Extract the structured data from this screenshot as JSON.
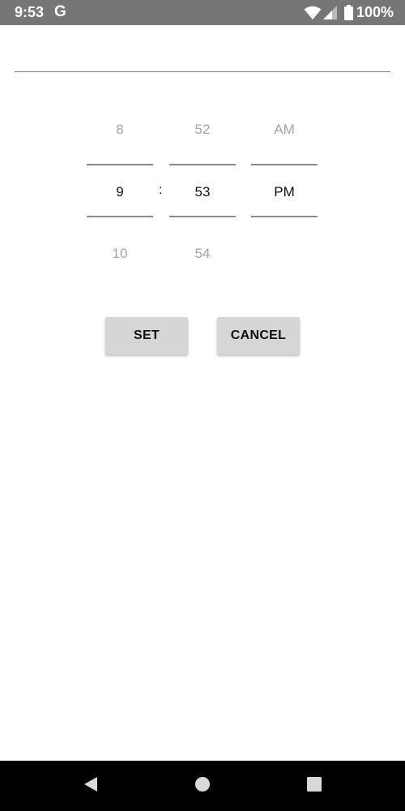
{
  "status_bar": {
    "time": "9:53",
    "google_glyph": "G",
    "battery_percent": "100%"
  },
  "time_picker": {
    "hour": {
      "prev": "8",
      "current": "9",
      "next": "10"
    },
    "separator": ":",
    "minute": {
      "prev": "52",
      "current": "53",
      "next": "54"
    },
    "ampm": {
      "prev": "AM",
      "current": "PM",
      "next": ""
    }
  },
  "buttons": {
    "set_label": "SET",
    "cancel_label": "CANCEL"
  },
  "icons": {
    "wifi": "wifi-icon",
    "signal": "cell-signal-icon",
    "battery": "battery-icon",
    "back": "back-triangle-icon",
    "home": "home-circle-icon",
    "recents": "recents-square-icon"
  },
  "colors": {
    "status_bar": "#767676",
    "button_bg": "#d6d6d6",
    "nav_bar": "#000000",
    "faded_text": "#a5a5a5"
  }
}
